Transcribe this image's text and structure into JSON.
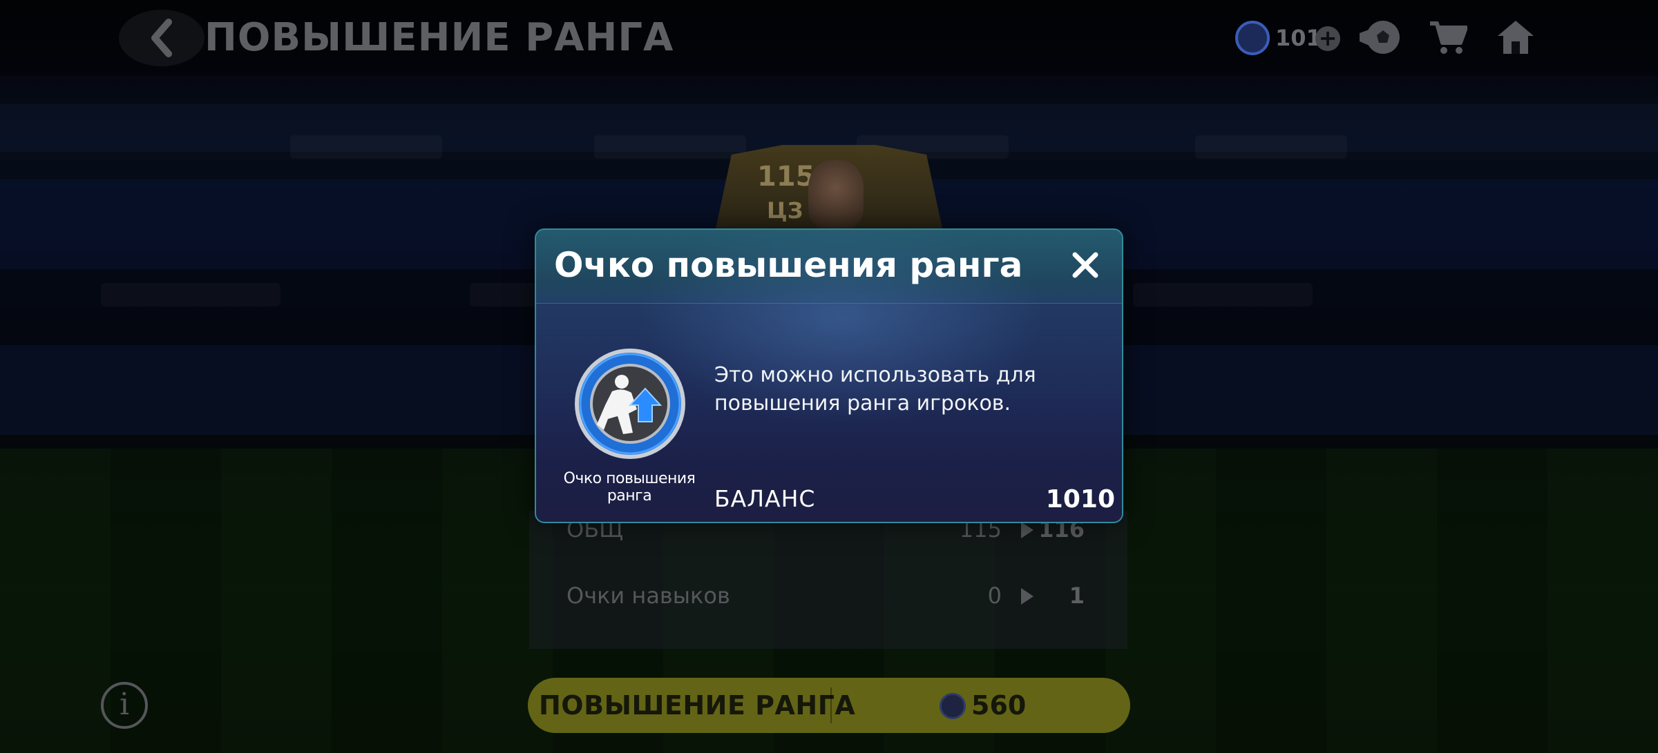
{
  "header": {
    "title": "ПОВЫШЕНИЕ РАНГА",
    "currency_amount": "1010"
  },
  "player_card": {
    "ovr": "115",
    "position": "ЦЗ"
  },
  "stats": [
    {
      "label": "ОБЩ",
      "from": "115",
      "to": "116"
    },
    {
      "label": "Очки навыков",
      "from": "0",
      "to": "1"
    }
  ],
  "rankup_button": {
    "label": "ПОВЫШЕНИЕ РАНГА",
    "cost": "560"
  },
  "modal": {
    "title": "Очко повышения ранга",
    "item_name": "Очко повышения ранга",
    "description": "Это можно использовать для повышения ранга игроков.",
    "balance_label": "БАЛАНС",
    "balance_value": "1010"
  },
  "icons": {
    "back": "chevron-left-icon",
    "currency": "rank-up-point-icon",
    "add": "plus-icon",
    "packs": "soccer-ball-icon",
    "store": "cart-icon",
    "home": "home-icon",
    "info": "info-icon",
    "close": "close-icon"
  },
  "colors": {
    "modal_border": "#2f8c9c",
    "rankup_button_bg": "#636416",
    "badge_blue": "#1e73d8"
  }
}
